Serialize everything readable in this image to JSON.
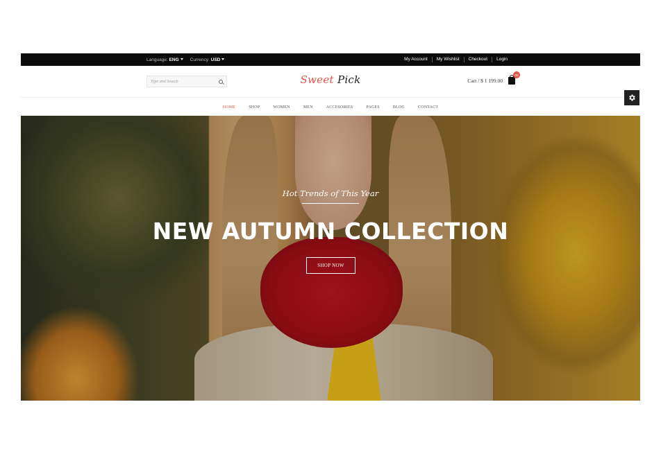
{
  "topbar": {
    "language_label": "Language:",
    "language_value": "ENG",
    "currency_label": "Currency:",
    "currency_value": "USD",
    "links": [
      "My Account",
      "My Wishlist",
      "Checkout",
      "Login"
    ]
  },
  "header": {
    "search_placeholder": "Type and Search",
    "logo_part1": "Sweet",
    "logo_part2": "Pick",
    "cart_text": "Cart / $ 1 199.00",
    "cart_count": "00"
  },
  "nav": {
    "items": [
      "HOME",
      "SHOP",
      "WOMEN",
      "MEN",
      "ACCESORIES",
      "PAGES",
      "BLOG",
      "CONTACT"
    ],
    "active": "HOME"
  },
  "hero": {
    "tagline": "Hot Trends of This Year",
    "headline": "NEW AUTUMN COLLECTION",
    "cta": "SHOP NOW"
  },
  "colors": {
    "accent": "#e0564a",
    "topbar_bg": "#0b0b0b"
  },
  "icons": {
    "search": "search-icon",
    "cart": "shopping-bag-icon",
    "settings": "gear-icon"
  }
}
